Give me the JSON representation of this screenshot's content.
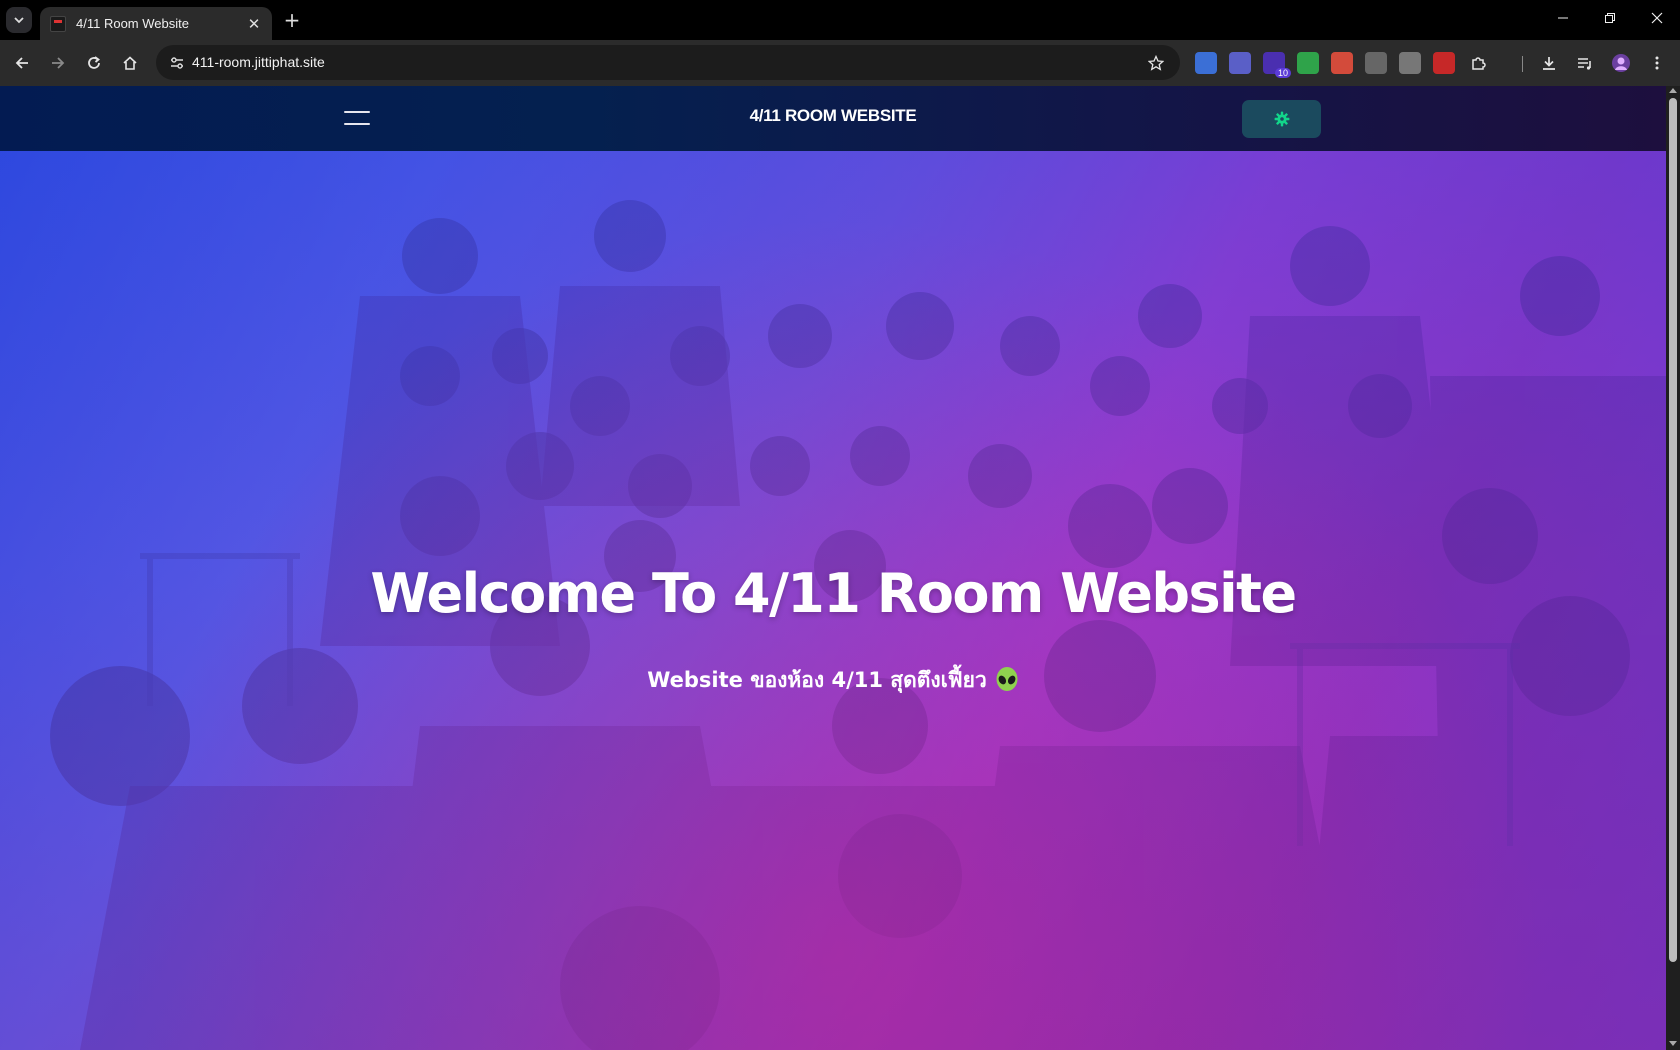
{
  "browser": {
    "tab_title": "4/11 Room Website",
    "url": "411-room.jittiphat.site",
    "extensions": [
      {
        "name": "translate-extension-icon",
        "color": "#3b6fd6",
        "badge": ""
      },
      {
        "name": "teams-extension-icon",
        "color": "#5a5fc7",
        "badge": ""
      },
      {
        "name": "grad-cap-extension-icon",
        "color": "#4a2fb0",
        "badge": "10"
      },
      {
        "name": "shield-extension-icon",
        "color": "#2fa34a",
        "badge": ""
      },
      {
        "name": "wallet-extension-icon",
        "color": "#d34b3b",
        "badge": ""
      },
      {
        "name": "chat-extension-icon",
        "color": "#666666",
        "badge": ""
      },
      {
        "name": "vue-extension-icon",
        "color": "#777777",
        "badge": ""
      },
      {
        "name": "s-extension-icon",
        "color": "#c62828",
        "badge": ""
      }
    ]
  },
  "site": {
    "brand": "4/11 ROOM WEBSITE",
    "accent": "#12d68a"
  },
  "hero": {
    "title": "Welcome To 4/11 Room Website",
    "subtitle": "Website ของห้อง 4/11 สุดตึงเฟี้ยว"
  }
}
